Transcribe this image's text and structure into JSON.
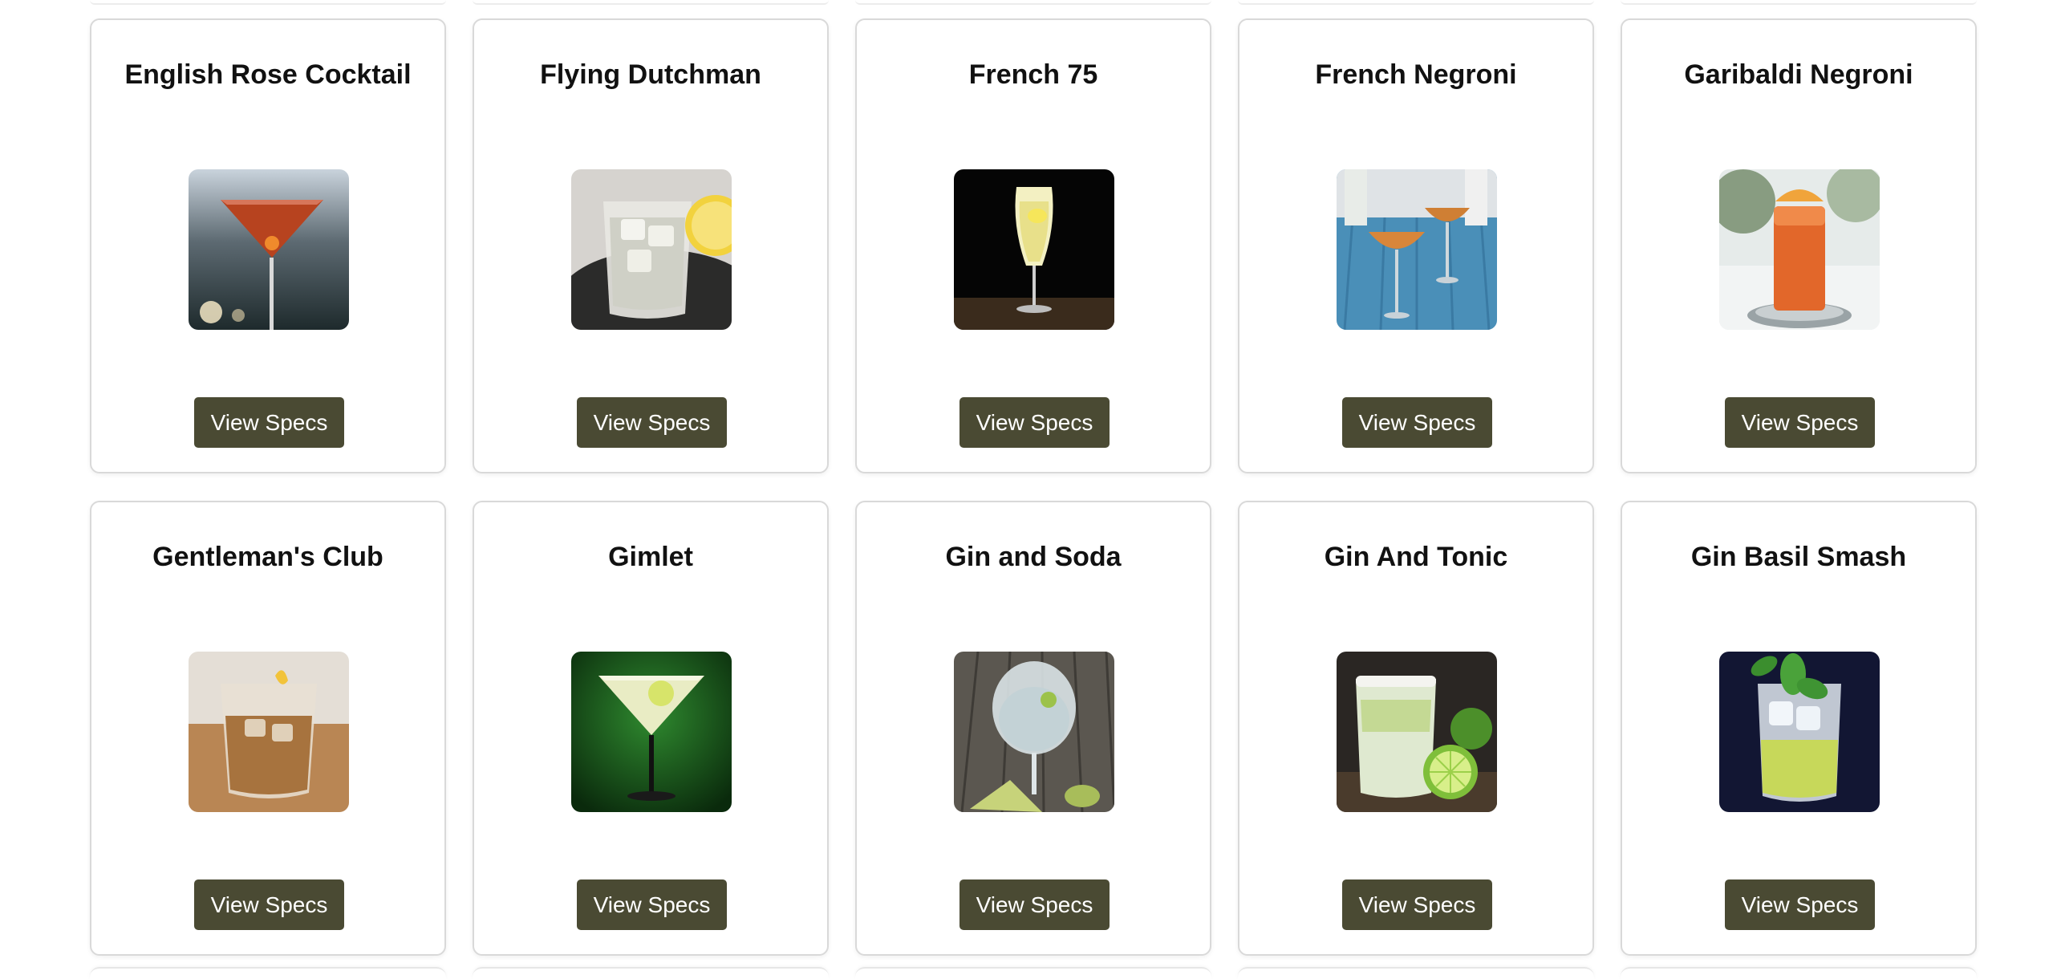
{
  "cocktails": [
    {
      "name": "English Rose Cocktail",
      "button_label": "View Specs",
      "image": "red-martini-glass-photo"
    },
    {
      "name": "Flying Dutchman",
      "button_label": "View Specs",
      "image": "rocks-glass-lemon-photo"
    },
    {
      "name": "French 75",
      "button_label": "View Specs",
      "image": "champagne-flute-photo"
    },
    {
      "name": "French Negroni",
      "button_label": "View Specs",
      "image": "coupe-glasses-blue-table-photo"
    },
    {
      "name": "Garibaldi Negroni",
      "button_label": "View Specs",
      "image": "orange-highball-photo"
    },
    {
      "name": "Gentleman's Club",
      "button_label": "View Specs",
      "image": "amber-rocks-glass-photo"
    },
    {
      "name": "Gimlet",
      "button_label": "View Specs",
      "image": "martini-glass-green-photo"
    },
    {
      "name": "Gin and Soda",
      "button_label": "View Specs",
      "image": "gin-copa-lime-photo"
    },
    {
      "name": "Gin And Tonic",
      "button_label": "View Specs",
      "image": "salted-rim-lime-photo"
    },
    {
      "name": "Gin Basil Smash",
      "button_label": "View Specs",
      "image": "basil-smash-glass-photo"
    }
  ],
  "colors": {
    "button_bg": "#4a4a33",
    "button_text": "#ffffff",
    "card_border": "#d9d9d9"
  }
}
